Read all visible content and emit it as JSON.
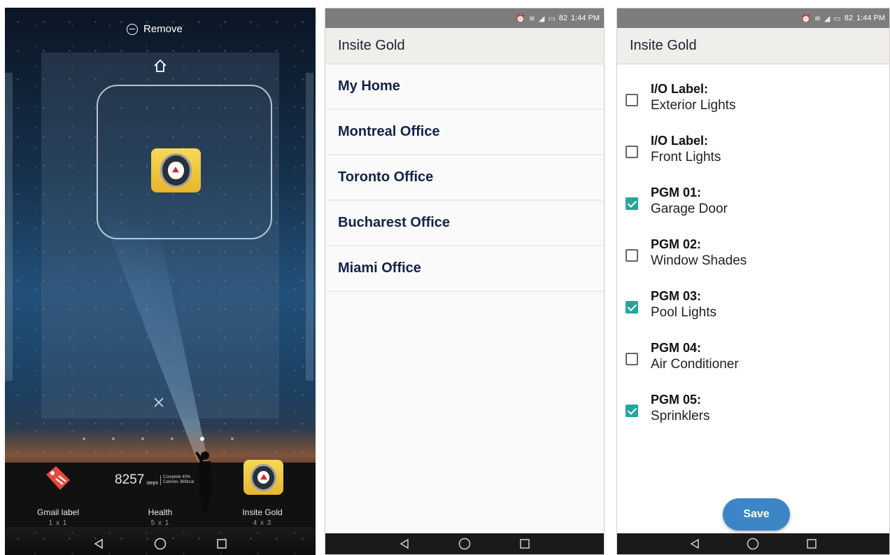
{
  "launcher": {
    "remove_label": "Remove",
    "widgets": [
      {
        "label": "Gmail label",
        "size": "1 x 1"
      },
      {
        "label": "Health",
        "size": "5 x 1"
      },
      {
        "label": "Insite Gold",
        "size": "4 x 3"
      }
    ],
    "health": {
      "steps": "8257",
      "unit": "steps",
      "line1": "Complete 40%",
      "line2": "Calories 368kcal"
    },
    "page_indicator": {
      "count": 6,
      "active_index": 4
    }
  },
  "sites_screen": {
    "status_time": "1:44 PM",
    "battery": "82",
    "app_title": "Insite Gold",
    "sites": [
      "My Home",
      "Montreal Office",
      "Toronto Office",
      "Bucharest Office",
      "Miami Office"
    ]
  },
  "io_screen": {
    "status_time": "1:44 PM",
    "battery": "82",
    "app_title": "Insite Gold",
    "items": [
      {
        "title": "I/O Label:",
        "value": "Exterior Lights",
        "checked": false
      },
      {
        "title": "I/O Label:",
        "value": "Front Lights",
        "checked": false
      },
      {
        "title": "PGM 01:",
        "value": "Garage Door",
        "checked": true
      },
      {
        "title": "PGM 02:",
        "value": "Window Shades",
        "checked": false
      },
      {
        "title": "PGM 03:",
        "value": "Pool Lights",
        "checked": true
      },
      {
        "title": "PGM 04:",
        "value": "Air Conditioner",
        "checked": false
      },
      {
        "title": "PGM 05:",
        "value": "Sprinklers",
        "checked": true
      }
    ],
    "save_label": "Save"
  },
  "colors": {
    "accent_checkbox": "#26a69a",
    "save_button": "#3c86c6",
    "site_text": "#14224a"
  },
  "icons": [
    "remove-icon",
    "home-icon",
    "close-icon",
    "gmail-label-icon",
    "insite-gold-app-icon",
    "back-icon",
    "home-nav-icon",
    "recents-icon",
    "alarm-icon",
    "wifi-icon",
    "signal-icon",
    "battery-icon"
  ]
}
